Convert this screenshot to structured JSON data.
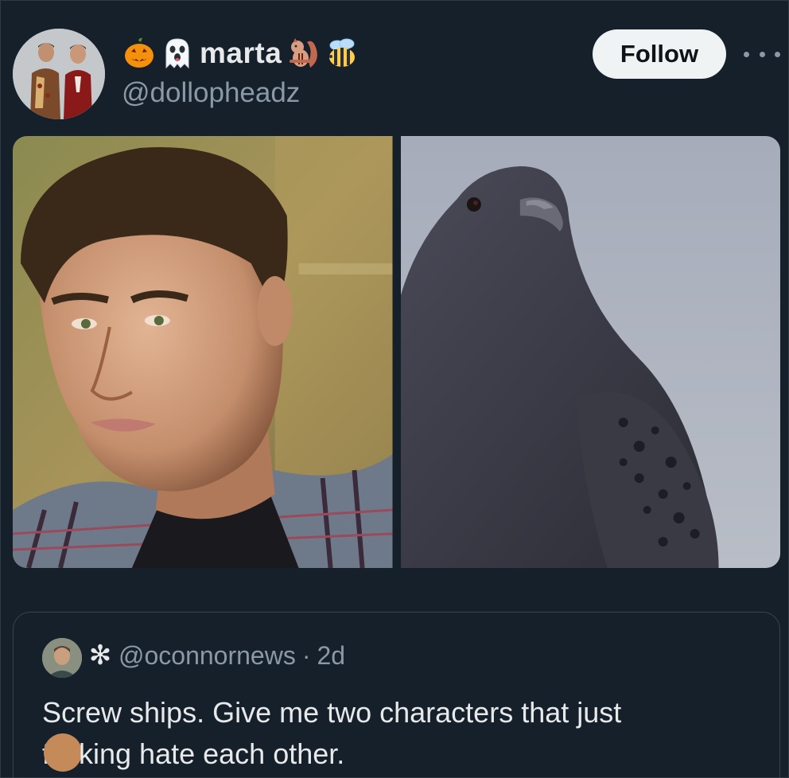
{
  "author": {
    "display_name": "marta",
    "handle": "@dollopheadz",
    "emojis_before": [
      "jack-o-lantern-icon",
      "ghost-icon"
    ],
    "emojis_after": [
      "chipmunk-icon",
      "bee-icon"
    ]
  },
  "actions": {
    "follow_label": "Follow"
  },
  "media": {
    "images": [
      "man-portrait-image",
      "pigeon-image"
    ]
  },
  "quoted_post": {
    "star": "✻",
    "handle": "@oconnornews",
    "separator": "·",
    "time": "2d",
    "text_line1": "Screw ships. Give me two characters that just",
    "text_line2_start": "f",
    "text_line2_end": "king hate each other."
  },
  "colors": {
    "background": "#15202b",
    "text_primary": "#e7e9ea",
    "text_secondary": "#8b98a5",
    "button_bg": "#eff3f4",
    "border": "#38444d"
  }
}
